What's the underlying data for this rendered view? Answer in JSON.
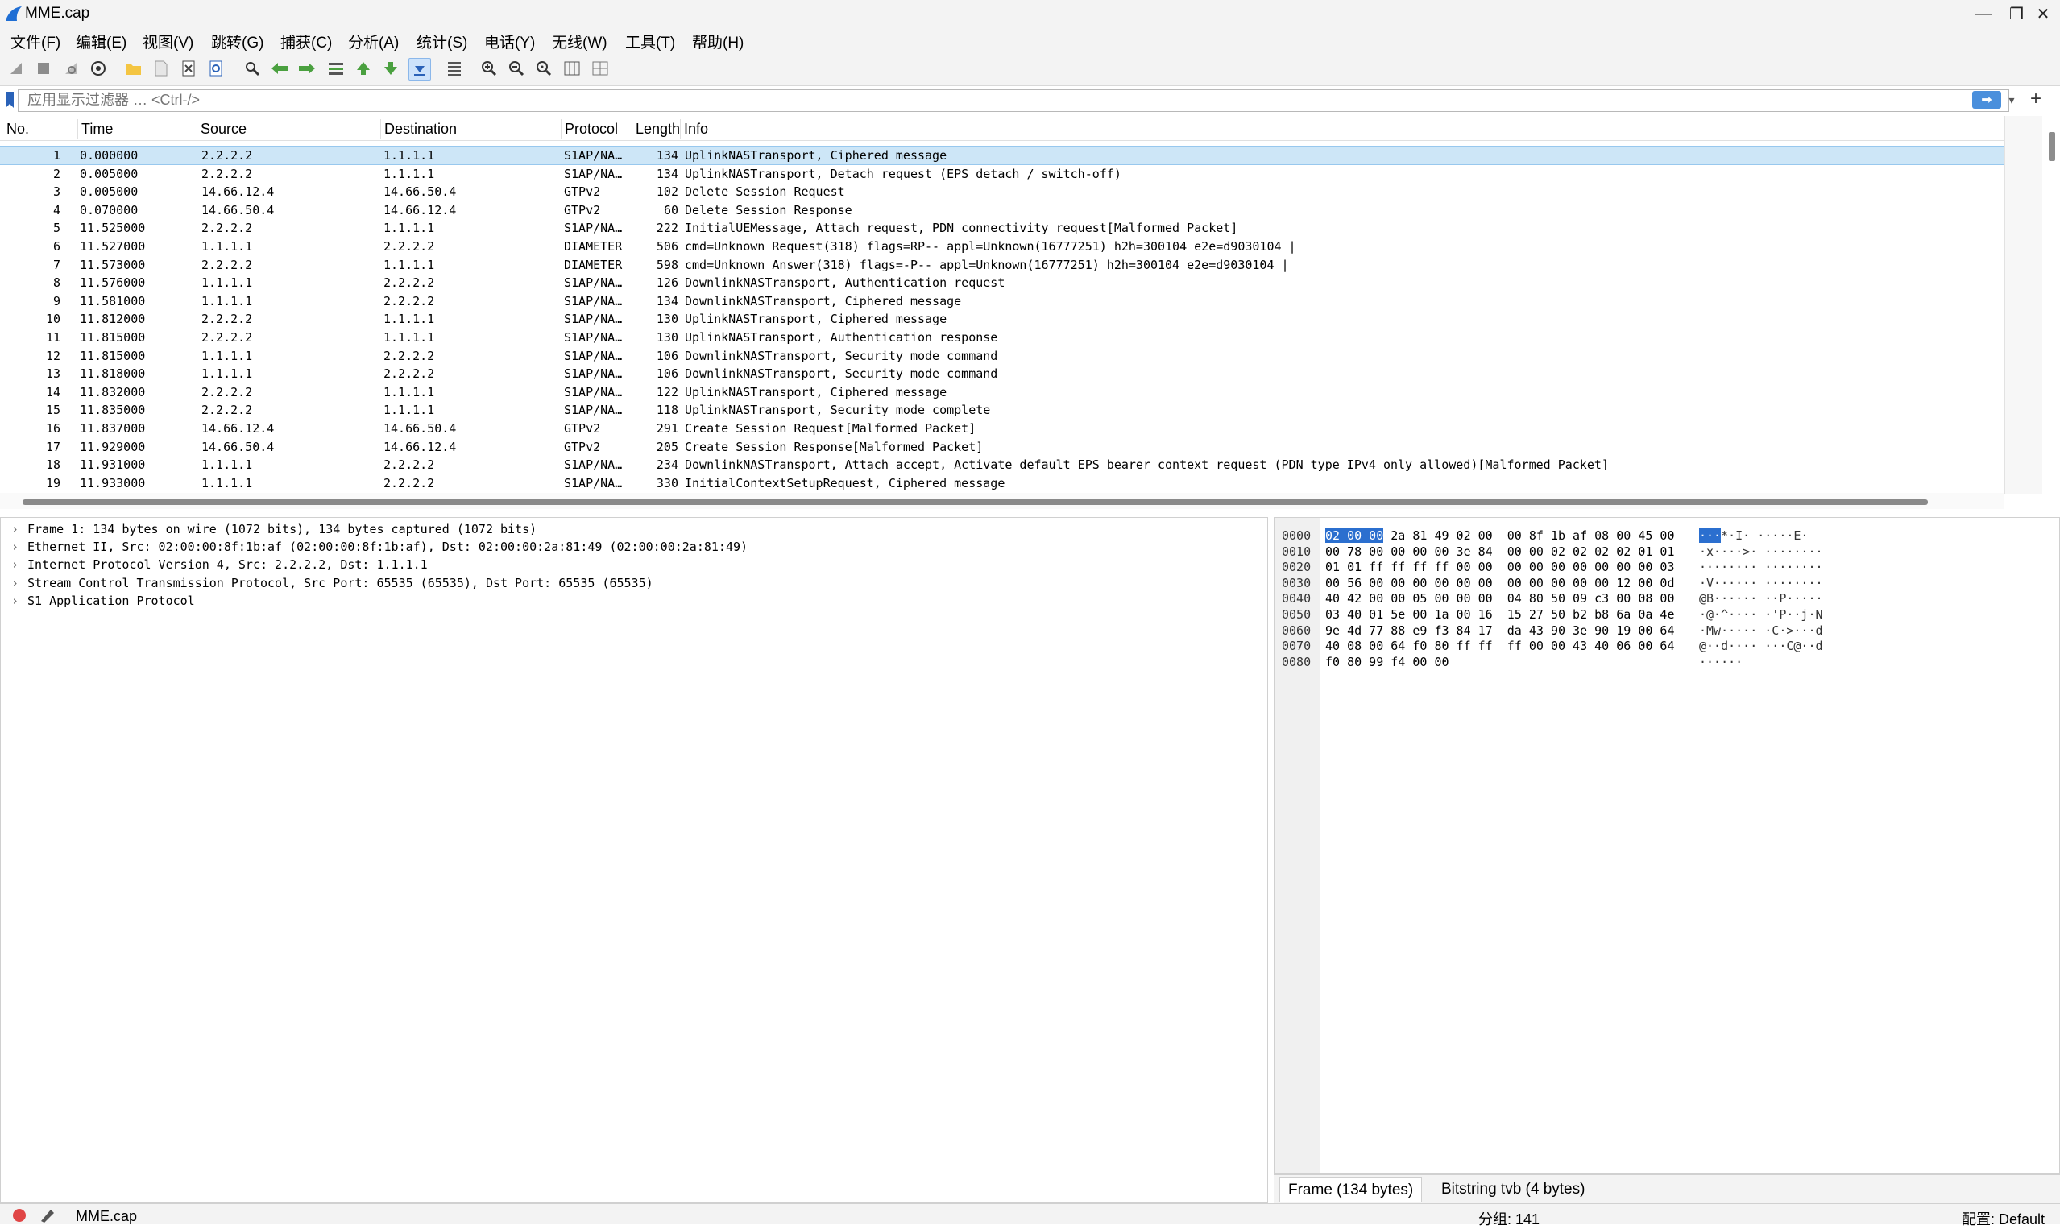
{
  "window": {
    "title": "MME.cap",
    "minimize": "—",
    "restore": "❐",
    "close": "✕"
  },
  "menu": [
    "文件(F)",
    "编辑(E)",
    "视图(V)",
    "跳转(G)",
    "捕获(C)",
    "分析(A)",
    "统计(S)",
    "电话(Y)",
    "无线(W)",
    "工具(T)",
    "帮助(H)"
  ],
  "filter": {
    "placeholder": "应用显示过滤器 … <Ctrl-/>",
    "apply_icon": "➡",
    "dropdown_icon": "▾",
    "add_icon": "+"
  },
  "columns": [
    "No.",
    "Time",
    "Source",
    "Destination",
    "Protocol",
    "Length",
    "Info"
  ],
  "packets": [
    {
      "no": "1",
      "time": "0.000000",
      "src": "2.2.2.2",
      "dst": "1.1.1.1",
      "proto": "S1AP/NA…",
      "len": "134",
      "info": "UplinkNASTransport, Ciphered message"
    },
    {
      "no": "2",
      "time": "0.005000",
      "src": "2.2.2.2",
      "dst": "1.1.1.1",
      "proto": "S1AP/NA…",
      "len": "134",
      "info": "UplinkNASTransport, Detach request (EPS detach / switch-off)"
    },
    {
      "no": "3",
      "time": "0.005000",
      "src": "14.66.12.4",
      "dst": "14.66.50.4",
      "proto": "GTPv2",
      "len": "102",
      "info": "Delete Session Request"
    },
    {
      "no": "4",
      "time": "0.070000",
      "src": "14.66.50.4",
      "dst": "14.66.12.4",
      "proto": "GTPv2",
      "len": "60",
      "info": "Delete Session Response"
    },
    {
      "no": "5",
      "time": "11.525000",
      "src": "2.2.2.2",
      "dst": "1.1.1.1",
      "proto": "S1AP/NA…",
      "len": "222",
      "info": "InitialUEMessage, Attach request, PDN connectivity request[Malformed Packet]"
    },
    {
      "no": "6",
      "time": "11.527000",
      "src": "1.1.1.1",
      "dst": "2.2.2.2",
      "proto": "DIAMETER",
      "len": "506",
      "info": "cmd=Unknown Request(318) flags=RP-- appl=Unknown(16777251) h2h=300104 e2e=d9030104 |"
    },
    {
      "no": "7",
      "time": "11.573000",
      "src": "2.2.2.2",
      "dst": "1.1.1.1",
      "proto": "DIAMETER",
      "len": "598",
      "info": "cmd=Unknown Answer(318) flags=-P-- appl=Unknown(16777251) h2h=300104 e2e=d9030104 |"
    },
    {
      "no": "8",
      "time": "11.576000",
      "src": "1.1.1.1",
      "dst": "2.2.2.2",
      "proto": "S1AP/NA…",
      "len": "126",
      "info": "DownlinkNASTransport, Authentication request"
    },
    {
      "no": "9",
      "time": "11.581000",
      "src": "1.1.1.1",
      "dst": "2.2.2.2",
      "proto": "S1AP/NA…",
      "len": "134",
      "info": "DownlinkNASTransport, Ciphered message"
    },
    {
      "no": "10",
      "time": "11.812000",
      "src": "2.2.2.2",
      "dst": "1.1.1.1",
      "proto": "S1AP/NA…",
      "len": "130",
      "info": "UplinkNASTransport, Ciphered message"
    },
    {
      "no": "11",
      "time": "11.815000",
      "src": "2.2.2.2",
      "dst": "1.1.1.1",
      "proto": "S1AP/NA…",
      "len": "130",
      "info": "UplinkNASTransport, Authentication response"
    },
    {
      "no": "12",
      "time": "11.815000",
      "src": "1.1.1.1",
      "dst": "2.2.2.2",
      "proto": "S1AP/NA…",
      "len": "106",
      "info": "DownlinkNASTransport, Security mode command"
    },
    {
      "no": "13",
      "time": "11.818000",
      "src": "1.1.1.1",
      "dst": "2.2.2.2",
      "proto": "S1AP/NA…",
      "len": "106",
      "info": "DownlinkNASTransport, Security mode command"
    },
    {
      "no": "14",
      "time": "11.832000",
      "src": "2.2.2.2",
      "dst": "1.1.1.1",
      "proto": "S1AP/NA…",
      "len": "122",
      "info": "UplinkNASTransport, Ciphered message"
    },
    {
      "no": "15",
      "time": "11.835000",
      "src": "2.2.2.2",
      "dst": "1.1.1.1",
      "proto": "S1AP/NA…",
      "len": "118",
      "info": "UplinkNASTransport, Security mode complete"
    },
    {
      "no": "16",
      "time": "11.837000",
      "src": "14.66.12.4",
      "dst": "14.66.50.4",
      "proto": "GTPv2",
      "len": "291",
      "info": "Create Session Request[Malformed Packet]"
    },
    {
      "no": "17",
      "time": "11.929000",
      "src": "14.66.50.4",
      "dst": "14.66.12.4",
      "proto": "GTPv2",
      "len": "205",
      "info": "Create Session Response[Malformed Packet]"
    },
    {
      "no": "18",
      "time": "11.931000",
      "src": "1.1.1.1",
      "dst": "2.2.2.2",
      "proto": "S1AP/NA…",
      "len": "234",
      "info": "DownlinkNASTransport, Attach accept, Activate default EPS bearer context request (PDN type IPv4 only allowed)[Malformed Packet]"
    },
    {
      "no": "19",
      "time": "11.933000",
      "src": "1.1.1.1",
      "dst": "2.2.2.2",
      "proto": "S1AP/NA…",
      "len": "330",
      "info": "InitialContextSetupRequest, Ciphered message"
    }
  ],
  "details": [
    "Frame 1: 134 bytes on wire (1072 bits), 134 bytes captured (1072 bits)",
    "Ethernet II, Src: 02:00:00:8f:1b:af (02:00:00:8f:1b:af), Dst: 02:00:00:2a:81:49 (02:00:00:2a:81:49)",
    "Internet Protocol Version 4, Src: 2.2.2.2, Dst: 1.1.1.1",
    "Stream Control Transmission Protocol, Src Port: 65535 (65535), Dst Port: 65535 (65535)",
    "S1 Application Protocol"
  ],
  "bytes": {
    "highlight": "02 00 00",
    "highlight_ascii": "···",
    "rows": [
      {
        "off": "0000",
        "hex": " 2a 81 49 02 00  00 8f 1b af 08 00 45 00",
        "ascii": "*·I· ·····E·"
      },
      {
        "off": "0010",
        "hex": "00 78 00 00 00 00 3e 84  00 00 02 02 02 02 01 01",
        "ascii": "·x····>· ········"
      },
      {
        "off": "0020",
        "hex": "01 01 ff ff ff ff 00 00  00 00 00 00 00 00 00 03",
        "ascii": "········ ········"
      },
      {
        "off": "0030",
        "hex": "00 56 00 00 00 00 00 00  00 00 00 00 00 12 00 0d",
        "ascii": "·V······ ········"
      },
      {
        "off": "0040",
        "hex": "40 42 00 00 05 00 00 00  04 80 50 09 c3 00 08 00",
        "ascii": "@B······ ··P·····"
      },
      {
        "off": "0050",
        "hex": "03 40 01 5e 00 1a 00 16  15 27 50 b2 b8 6a 0a 4e",
        "ascii": "·@·^···· ·'P··j·N"
      },
      {
        "off": "0060",
        "hex": "9e 4d 77 88 e9 f3 84 17  da 43 90 3e 90 19 00 64",
        "ascii": "·Mw····· ·C·>···d"
      },
      {
        "off": "0070",
        "hex": "40 08 00 64 f0 80 ff ff  ff 00 00 43 40 06 00 64",
        "ascii": "@··d···· ···C@··d"
      },
      {
        "off": "0080",
        "hex": "f0 80 99 f4 00 00",
        "ascii": "······"
      }
    ]
  },
  "bytes_tabs": [
    "Frame (134 bytes)",
    "Bitstring tvb (4 bytes)"
  ],
  "status": {
    "file": "MME.cap",
    "packets": "分组: 141",
    "profile": "配置: Default"
  },
  "colors": {
    "selected_row": "#cde6f7",
    "hex_highlight": "#2b6fcf",
    "apply_button": "#4a8fdc"
  }
}
